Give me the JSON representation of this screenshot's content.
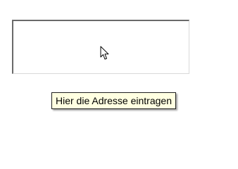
{
  "address_field": {
    "value": "",
    "cursor_icon": "arrow-pointer-icon"
  },
  "tooltip": {
    "text": "Hier die Adresse eintragen"
  },
  "colors": {
    "tooltip_background": "#ffffe1",
    "tooltip_border": "#1f1f1f",
    "field_border_dark": "#6a6a6a",
    "field_border_light": "#d9d9d9"
  }
}
